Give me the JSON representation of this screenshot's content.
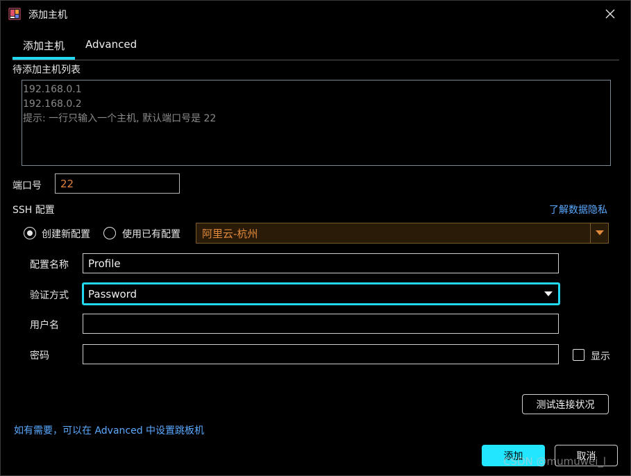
{
  "window": {
    "title": "添加主机"
  },
  "tabs": [
    {
      "label": "添加主机",
      "active": true
    },
    {
      "label": "Advanced",
      "active": false
    }
  ],
  "host_list": {
    "label": "待添加主机列表",
    "lines": [
      "192.168.0.1",
      "192.168.0.2",
      "提示: 一行只输入一个主机, 默认端口号是 22"
    ]
  },
  "port": {
    "label": "端口号",
    "value": "22"
  },
  "ssh": {
    "label": "SSH 配置",
    "privacy_link": "了解数据隐私",
    "radio_new": "创建新配置",
    "radio_existing": "使用已有配置",
    "existing_profile": "阿里云-杭州",
    "profile_name_label": "配置名称",
    "profile_name_value": "Profile",
    "auth_label": "验证方式",
    "auth_value": "Password",
    "username_label": "用户名",
    "username_value": "",
    "password_label": "密码",
    "password_value": "",
    "show_label": "显示"
  },
  "buttons": {
    "test": "测试连接状况",
    "add": "添加",
    "cancel": "取消"
  },
  "hint_link": "如有需要，可以在 Advanced 中设置跳板机",
  "watermark": "CSDN @mumuwei_l",
  "colors": {
    "accent": "#22d8f0",
    "link": "#5aa9ff",
    "orange": "#e0823c"
  }
}
